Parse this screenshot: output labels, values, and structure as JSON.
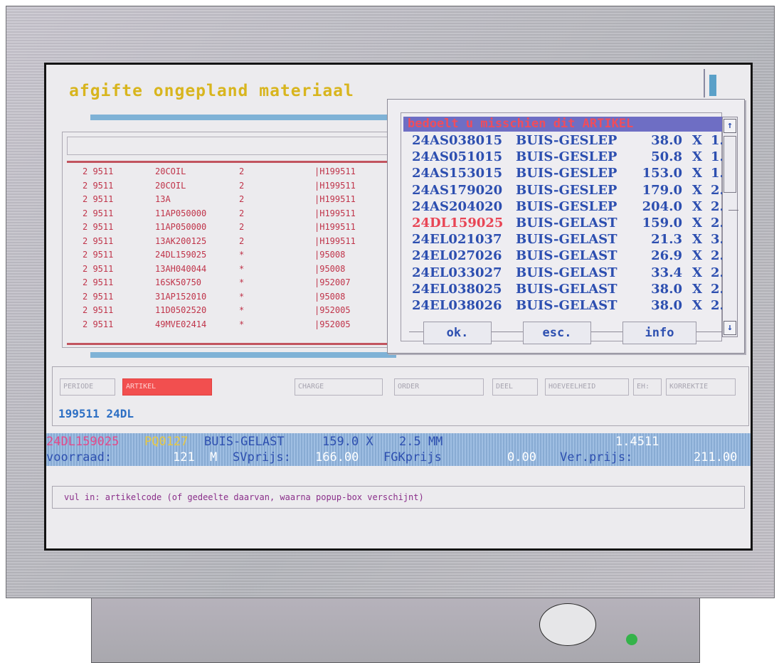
{
  "screen": {
    "title": "afgifte ongepland materiaal"
  },
  "artikel_list": {
    "rows": [
      {
        "per": "2 9511",
        "code": "20COIL",
        "qty": "2",
        "ref": "|H199511"
      },
      {
        "per": "2 9511",
        "code": "20COIL",
        "qty": "2",
        "ref": "|H199511"
      },
      {
        "per": "2 9511",
        "code": "13A",
        "qty": "2",
        "ref": "|H199511"
      },
      {
        "per": "2 9511",
        "code": "11AP050000",
        "qty": "2",
        "ref": "|H199511"
      },
      {
        "per": "2 9511",
        "code": "11AP050000",
        "qty": "2",
        "ref": "|H199511"
      },
      {
        "per": "2 9511",
        "code": "13AK200125",
        "qty": "2",
        "ref": "|H199511"
      },
      {
        "per": "2 9511",
        "code": "24DL159025",
        "qty": "*",
        "ref": "|95008"
      },
      {
        "per": "2 9511",
        "code": "13AH040044",
        "qty": "*",
        "ref": "|95008"
      },
      {
        "per": "2 9511",
        "code": "16SK50750",
        "qty": "*",
        "ref": "|952007"
      },
      {
        "per": "2 9511",
        "code": "31AP152010",
        "qty": "*",
        "ref": "|95008"
      },
      {
        "per": "2 9511",
        "code": "11D0502520",
        "qty": "*",
        "ref": "|952005"
      },
      {
        "per": "2 9511",
        "code": "49MVE02414",
        "qty": "*",
        "ref": "|952005"
      }
    ]
  },
  "popup": {
    "title": "bedoelt u misschien dit ARTIKEL",
    "rows": [
      {
        "code": "24AS038015",
        "desc": "BUIS-GESLEP",
        "size": "38.0",
        "x": "X",
        "wall": "1."
      },
      {
        "code": "24AS051015",
        "desc": "BUIS-GESLEP",
        "size": "50.8",
        "x": "X",
        "wall": "1."
      },
      {
        "code": "24AS153015",
        "desc": "BUIS-GESLEP",
        "size": "153.0",
        "x": "X",
        "wall": "1."
      },
      {
        "code": "24AS179020",
        "desc": "BUIS-GESLEP",
        "size": "179.0",
        "x": "X",
        "wall": "2."
      },
      {
        "code": "24AS204020",
        "desc": "BUIS-GESLEP",
        "size": "204.0",
        "x": "X",
        "wall": "2."
      },
      {
        "code": "24DL159025",
        "desc": "BUIS-GELAST",
        "size": "159.0",
        "x": "X",
        "wall": "2."
      },
      {
        "code": "24EL021037",
        "desc": "BUIS-GELAST",
        "size": "21.3",
        "x": "X",
        "wall": "3."
      },
      {
        "code": "24EL027026",
        "desc": "BUIS-GELAST",
        "size": "26.9",
        "x": "X",
        "wall": "2."
      },
      {
        "code": "24EL033027",
        "desc": "BUIS-GELAST",
        "size": "33.4",
        "x": "X",
        "wall": "2."
      },
      {
        "code": "24EL038025",
        "desc": "BUIS-GELAST",
        "size": "38.0",
        "x": "X",
        "wall": "2."
      },
      {
        "code": "24EL038026",
        "desc": "BUIS-GELAST",
        "size": "38.0",
        "x": "X",
        "wall": "2."
      }
    ],
    "highlighted_index": 5,
    "buttons": {
      "ok": "ok.",
      "esc": "esc.",
      "info": "info"
    },
    "scroll": {
      "up_icon": "arrow-up-icon",
      "down_icon": "arrow-down-icon",
      "up_glyph": "↑",
      "down_glyph": "↓"
    }
  },
  "form": {
    "fields": {
      "periode": "PERIODE",
      "artikel": "ARTIKEL",
      "charge": "CHARGE",
      "order": "ORDER",
      "deel": "DEEL",
      "hoeveelheid": "HOEVEELHEID",
      "eh": "EH:",
      "korrektie": "KORREKTIE"
    },
    "entry_value": "199511 24DL"
  },
  "status": {
    "line1": {
      "code": "24DL159025",
      "sub": "PQ0127",
      "desc": "BUIS-GELAST",
      "size": "159.0 X",
      "wall": "2.5 MM",
      "factor": "1.4511"
    },
    "line2": {
      "voorraad_label": "voorraad:",
      "voorraad_value": "121",
      "unit": "M",
      "sv_label": "SVprijs:",
      "sv_value": "166.00",
      "fg_label": "FGKprijs",
      "fg_value": "0.00",
      "ver_label": "Ver.prijs:",
      "ver_value": "211.00"
    }
  },
  "message": {
    "hint": "vul in: artikelcode (of gedeelte daarvan, waarna popup-box verschijnt)"
  },
  "colors": {
    "title": "#d8b51e",
    "list_text": "#c0344a",
    "popup_text": "#2d4fb0",
    "highlight": "#e84555",
    "status_bar": "#8fb4de",
    "active_field": "#f24f4f"
  }
}
